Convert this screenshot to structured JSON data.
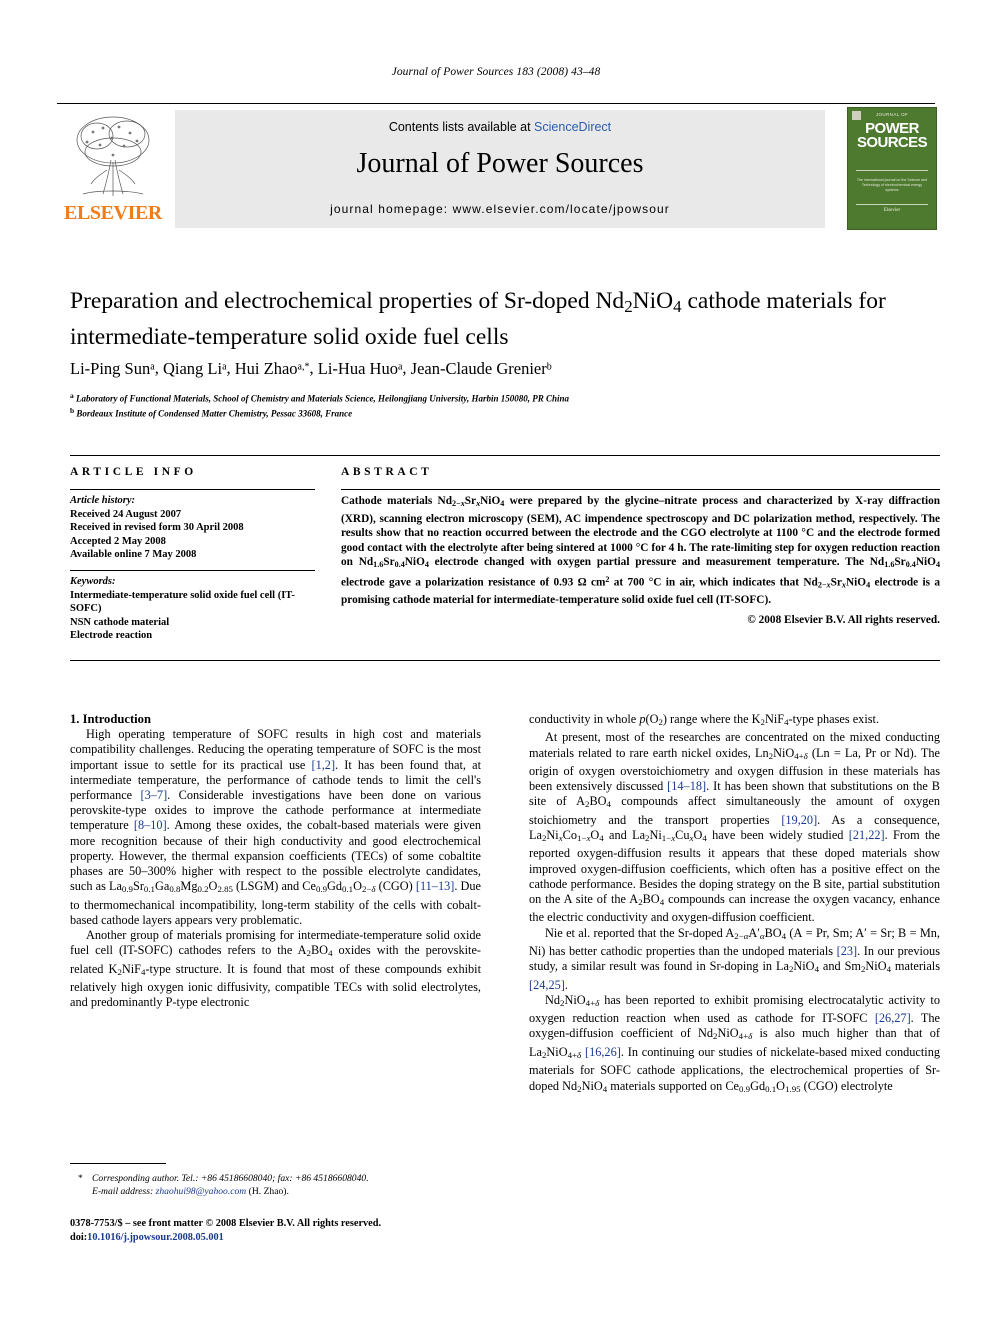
{
  "running_head": "Journal of Power Sources 183 (2008) 43–48",
  "masthead": {
    "contents_prefix": "Contents lists available at ",
    "sciencedirect": "ScienceDirect",
    "journal_title": "Journal of Power Sources",
    "homepage": "journal homepage: www.elsevier.com/locate/jpowsour",
    "publisher": "ELSEVIER",
    "cover": {
      "top_label": "JOURNAL OF",
      "line1": "POWER",
      "line2": "SOURCES",
      "blurb": "The international journal on the Science and Technology of electrochemical energy systems",
      "bottom": "Elsevier"
    },
    "accent_color": "#F07D1A",
    "link_color": "#2a5db0"
  },
  "article": {
    "title_part1": "Preparation and electrochemical properties of Sr-doped Nd",
    "title_sub1": "2",
    "title_part2": "NiO",
    "title_sub2": "4",
    "title_part3": " cathode materials for intermediate-temperature solid oxide fuel cells",
    "title_plain": "Preparation and electrochemical properties of Sr-doped Nd2NiO4 cathode materials for intermediate-temperature solid oxide fuel cells",
    "authors": [
      {
        "name": "Li-Ping Sun",
        "marks": "a"
      },
      {
        "name": "Qiang Li",
        "marks": "a"
      },
      {
        "name": "Hui Zhao",
        "marks": "a,*"
      },
      {
        "name": "Li-Hua Huo",
        "marks": "a"
      },
      {
        "name": "Jean-Claude Grenier",
        "marks": "b"
      }
    ],
    "affiliations": [
      {
        "mark": "a",
        "text": "Laboratory of Functional Materials, School of Chemistry and Materials Science, Heilongjiang University, Harbin 150080, PR China"
      },
      {
        "mark": "b",
        "text": "Bordeaux Institute of Condensed Matter Chemistry, Pessac 33608, France"
      }
    ]
  },
  "info": {
    "heading": "ARTICLE INFO",
    "history_label": "Article history:",
    "history": [
      "Received 24 August 2007",
      "Received in revised form 30 April 2008",
      "Accepted 2 May 2008",
      "Available online 7 May 2008"
    ],
    "keywords_label": "Keywords:",
    "keywords": [
      "Intermediate-temperature solid oxide fuel cell (IT-SOFC)",
      "NSN cathode material",
      "Electrode reaction"
    ]
  },
  "abstract": {
    "heading": "ABSTRACT",
    "copyright": "© 2008 Elsevier B.V. All rights reserved."
  },
  "body": {
    "intro_heading": "1. Introduction"
  },
  "footnote": {
    "star": "*",
    "corresponding": "Corresponding author. Tel.: +86 45186608040; fax: +86 45186608040.",
    "email_label": "E-mail address:",
    "email": "zhaohui98@yahoo.com",
    "email_suffix": "(H. Zhao)."
  },
  "footer": {
    "issn_line": "0378-7753/$ – see front matter © 2008 Elsevier B.V. All rights reserved.",
    "doi_label": "doi:",
    "doi": "10.1016/j.jpowsour.2008.05.001"
  }
}
